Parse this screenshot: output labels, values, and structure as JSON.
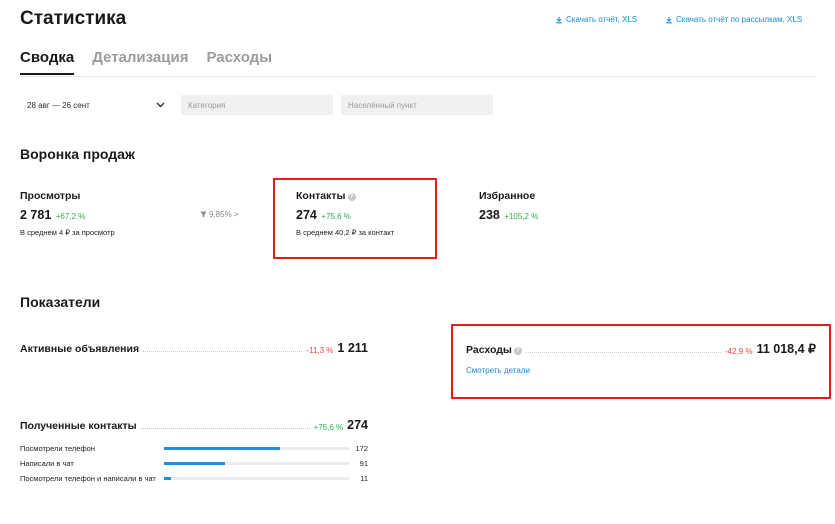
{
  "header": {
    "title": "Статистика",
    "download_report": "Скачать отчёт, XLS",
    "download_mailing_report": "Скачать отчёт по рассылкам, XLS"
  },
  "tabs": [
    {
      "label": "Сводка"
    },
    {
      "label": "Детализация"
    },
    {
      "label": "Расходы"
    }
  ],
  "filters": {
    "date_range": "28 авг — 26 сент",
    "category_placeholder": "Категория",
    "location_placeholder": "Населённый пункт"
  },
  "funnel": {
    "title": "Воронка продаж",
    "views": {
      "label": "Просмотры",
      "value": "2 781",
      "change": "+67,2 %",
      "note": "В среднем 4 ₽ за просмотр"
    },
    "conversion": "9,85% >",
    "contacts": {
      "label": "Контакты",
      "value": "274",
      "change": "+75,6 %",
      "note": "В среднем 40,2 ₽ за контакт"
    },
    "favorites": {
      "label": "Избранное",
      "value": "238",
      "change": "+105,2 %"
    }
  },
  "indicators": {
    "title": "Показатели",
    "active_ads": {
      "label": "Активные объявления",
      "change": "-11,3 %",
      "value": "1 211"
    },
    "expenses": {
      "label": "Расходы",
      "change": "-42,9 %",
      "value": "11 018,4 ₽",
      "link": "Смотреть детали"
    },
    "contacts_received": {
      "label": "Полученные контакты",
      "change": "+75,6 %",
      "value": "274",
      "rows": [
        {
          "label": "Посмотрели телефон",
          "value": "172",
          "share": 0.6277
        },
        {
          "label": "Написали в чат",
          "value": "91",
          "share": 0.3321
        },
        {
          "label": "Посмотрели телефон и написали в чат",
          "value": "11",
          "share": 0.0401
        }
      ]
    }
  },
  "colors": {
    "accent": "#1a8ad5",
    "positive": "#2bb24c",
    "negative": "#e5484d",
    "highlight": "#e21c1c",
    "bar": "#1e90e3"
  }
}
